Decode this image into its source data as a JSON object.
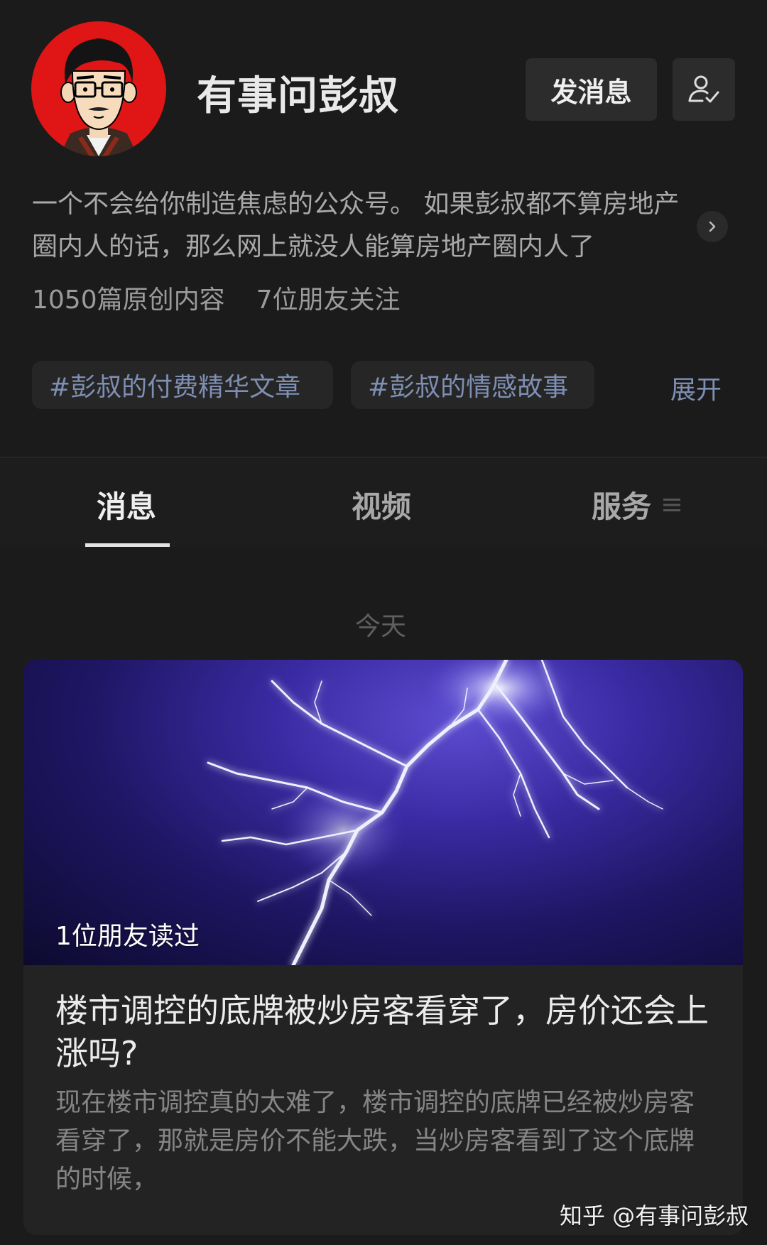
{
  "header": {
    "account_name": "有事问彭叔",
    "message_button": "发消息",
    "follow_icon": "user-check-icon"
  },
  "profile": {
    "description": "一个不会给你制造焦虑的公众号。 如果彭叔都不算房地产圈内人的话，那么网上就没人能算房地产圈内人了",
    "original_count": "1050篇原创内容",
    "friends_following": "7位朋友关注"
  },
  "tags": {
    "items": [
      "#彭叔的付费精华文章",
      "#彭叔的情感故事"
    ],
    "expand_label": "展开"
  },
  "tabs": {
    "items": [
      "消息",
      "视频",
      "服务"
    ],
    "active": "消息"
  },
  "feed": {
    "date_label": "今天",
    "article": {
      "read_badge": "1位朋友读过",
      "title": "楼市调控的底牌被炒房客看穿了，房价还会上涨吗?",
      "summary": "现在楼市调控真的太难了，楼市调控的底牌已经被炒房客看穿了，那就是房价不能大跌，当炒房客看到了这个底牌的时候，"
    }
  },
  "watermark": {
    "text": "知乎 @有事问彭叔",
    "weibo_text": "@有事问彭叔"
  },
  "colors": {
    "background": "#1b1b1b",
    "avatar_ring": "#e01515",
    "tag_text": "#7e8fb3",
    "card_bg": "#232323"
  }
}
